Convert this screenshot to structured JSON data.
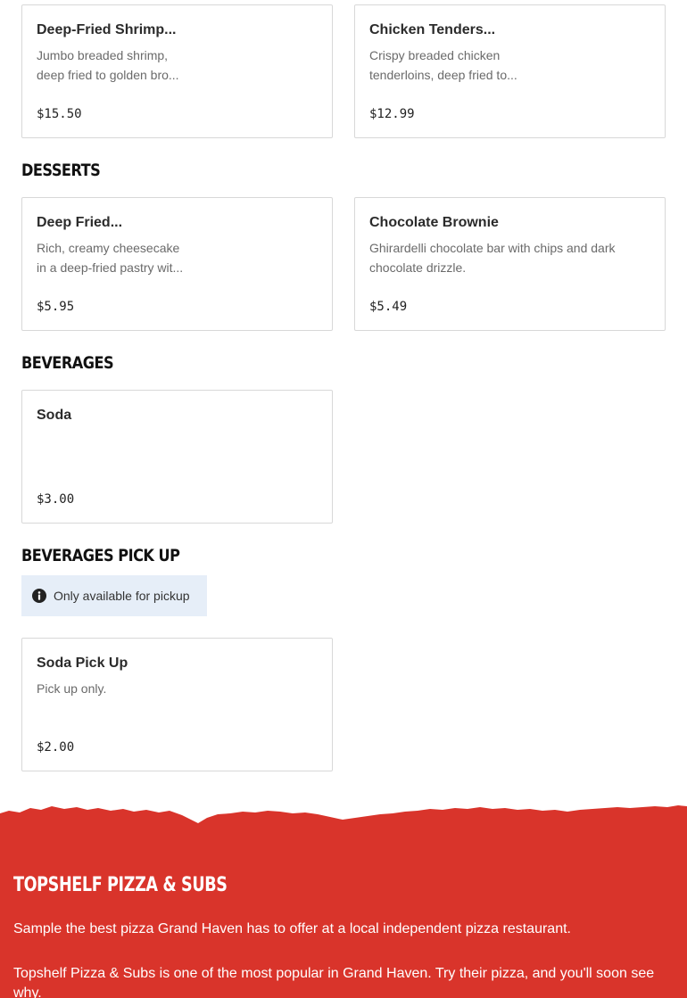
{
  "menu": {
    "items_top": [
      {
        "title": "Deep-Fried Shrimp...",
        "description": "Jumbo breaded shrimp, deep fried to golden bro...",
        "price": "$15.50"
      },
      {
        "title": "Chicken Tenders...",
        "description": "Crispy breaded chicken tenderloins, deep fried to...",
        "price": "$12.99"
      }
    ],
    "sections": [
      {
        "title": "DESSERTS",
        "items": [
          {
            "title": "Deep Fried...",
            "description": "Rich, creamy cheesecake in a deep-fried pastry wit...",
            "price": "$5.95"
          },
          {
            "title": "Chocolate Brownie",
            "description": "Ghirardelli chocolate bar with chips and dark chocolate drizzle.",
            "price": "$5.49"
          }
        ]
      },
      {
        "title": "BEVERAGES",
        "items": [
          {
            "title": "Soda",
            "description": "",
            "price": "$3.00"
          }
        ]
      },
      {
        "title": "BEVERAGES PICK UP",
        "notice": "Only available for pickup",
        "items": [
          {
            "title": "Soda Pick Up",
            "description": "Pick up only.",
            "price": "$2.00"
          }
        ]
      }
    ]
  },
  "footer": {
    "brand": "TOPSHELF PIZZA & SUBS",
    "tagline": "Sample the best pizza Grand Haven has to offer at a local independent pizza restaurant.",
    "blurb": "Topshelf Pizza & Subs is one of the most popular in Grand Haven. Try their pizza, and you'll soon see why."
  },
  "colors": {
    "footer_background": "#d9342b",
    "notice_background": "#e6eef8",
    "card_border": "#d8d8d8"
  },
  "icons": {
    "notice_icon": "info-circle-icon"
  }
}
